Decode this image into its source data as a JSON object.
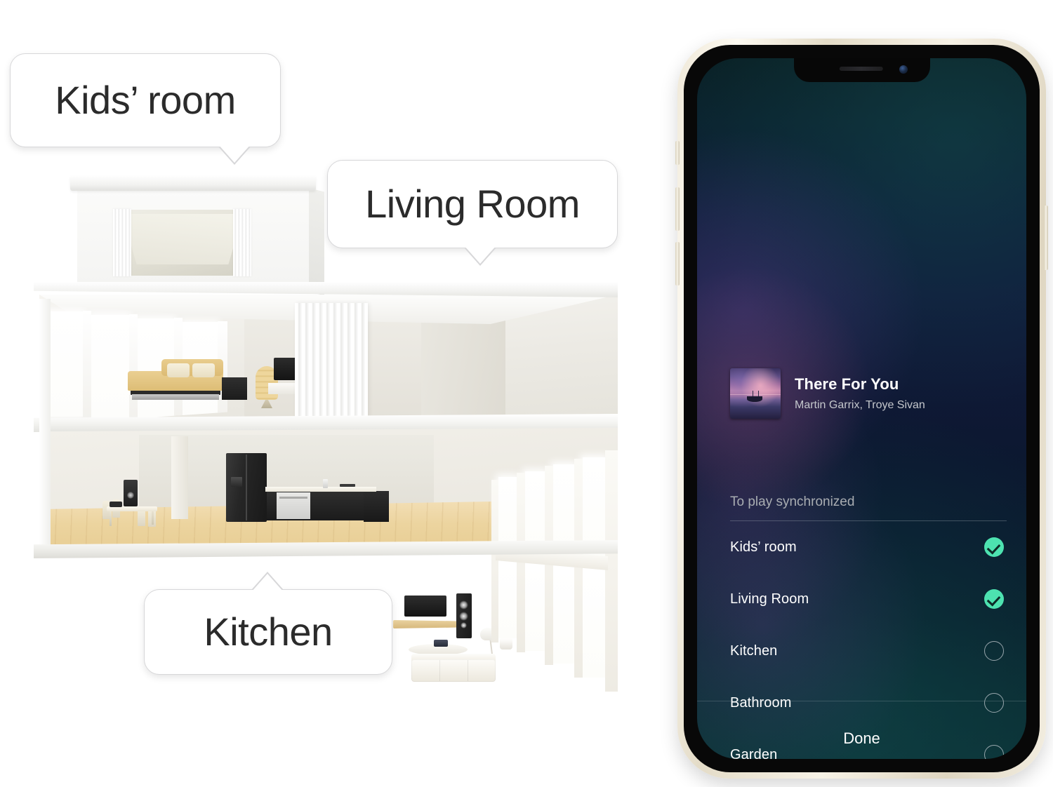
{
  "callouts": [
    {
      "id": "kids",
      "label": "Kids’ room"
    },
    {
      "id": "living",
      "label": "Living Room"
    },
    {
      "id": "kitchen",
      "label": "Kitchen"
    }
  ],
  "illustration": {
    "name": "dollhouse-cutaway",
    "description": "White cutaway dollhouse with attic bedroom, first-floor kids' room and ground-floor kitchen, dining area and living room"
  },
  "phone": {
    "frame_color": "#efe8d8",
    "screen": {
      "now_playing": {
        "title": "There For You",
        "artist": "Martin Garrix, Troye Sivan",
        "album_art_alt": "twilight seascape with boat"
      },
      "section_header": "To play synchronized",
      "rooms": [
        {
          "label": "Kids’ room",
          "selected": true
        },
        {
          "label": "Living Room",
          "selected": true
        },
        {
          "label": "Kitchen",
          "selected": false
        },
        {
          "label": "Bathroom",
          "selected": false
        },
        {
          "label": "Garden",
          "selected": false
        }
      ],
      "done_label": "Done",
      "accent_color": "#4de2b0"
    },
    "hardware": {
      "mute_switch": "mute-switch",
      "volume_up": "volume-up-button",
      "volume_down": "volume-down-button",
      "power": "power-button",
      "notch_speaker": "earpiece-speaker",
      "notch_camera": "front-camera"
    }
  }
}
